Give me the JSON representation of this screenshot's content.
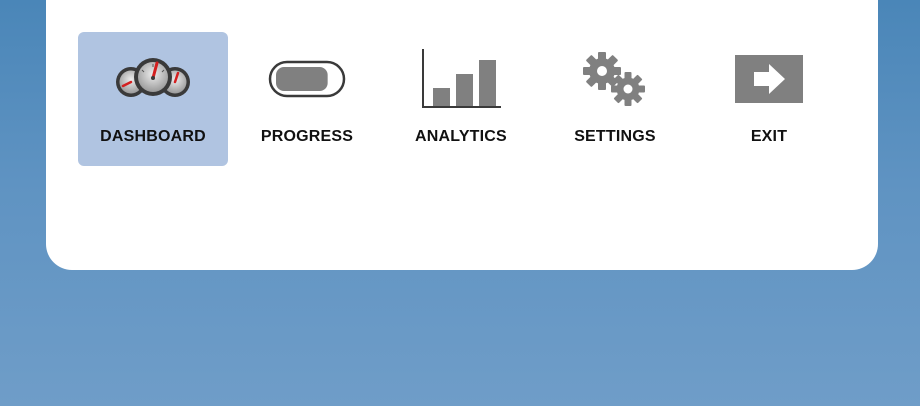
{
  "menu": {
    "items": [
      {
        "label": "DASHBOARD",
        "icon": "dashboard-gauges-icon",
        "active": true
      },
      {
        "label": "PROGRESS",
        "icon": "progress-bar-icon",
        "active": false
      },
      {
        "label": "ANALYTICS",
        "icon": "bar-chart-icon",
        "active": false
      },
      {
        "label": "SETTINGS",
        "icon": "gears-icon",
        "active": false
      },
      {
        "label": "EXIT",
        "icon": "exit-arrow-icon",
        "active": false
      }
    ]
  },
  "progress": {
    "value": 0.82
  },
  "colors": {
    "active_tab": "#b0c4e1",
    "icon_gray": "#808080",
    "gauge_needle": "#d42020",
    "background_top": "#4a86b8",
    "background_bottom": "#6f9dc8"
  }
}
